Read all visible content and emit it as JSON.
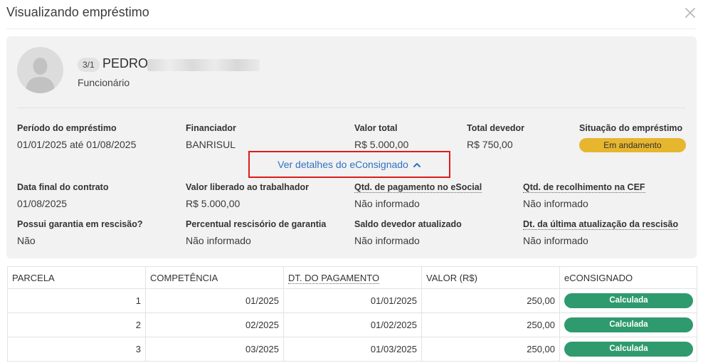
{
  "modal": {
    "title": "Visualizando empréstimo",
    "close_icon": "close-icon"
  },
  "employee": {
    "code": "3/1",
    "name": "PEDRO",
    "role": "Funcionário"
  },
  "summary": {
    "periodo_label": "Período do empréstimo",
    "periodo_value": "01/01/2025 até 01/08/2025",
    "financiador_label": "Financiador",
    "financiador_value": "BANRISUL",
    "valor_total_label": "Valor total",
    "valor_total_value": "R$ 5.000,00",
    "total_devedor_label": "Total devedor",
    "total_devedor_value": "R$ 750,00",
    "situacao_label": "Situação do empréstimo",
    "situacao_value": "Em andamento",
    "situacao_color": "#e7b62f"
  },
  "details_link": {
    "label": "Ver detalhes do eConsignado",
    "icon": "chevron-up-icon"
  },
  "details": {
    "data_final_label": "Data final do contrato",
    "data_final_value": "01/08/2025",
    "valor_liberado_label": "Valor liberado ao trabalhador",
    "valor_liberado_value": "R$ 5.000,00",
    "qtd_esocial_label": "Qtd. de pagamento no eSocial",
    "qtd_esocial_value": "Não informado",
    "qtd_cef_label": "Qtd. de recolhimento na CEF",
    "qtd_cef_value": "Não informado",
    "garantia_label": "Possui garantia em rescisão?",
    "garantia_value": "Não",
    "percentual_label": "Percentual rescisório de garantia",
    "percentual_value": "Não informado",
    "saldo_label": "Saldo devedor atualizado",
    "saldo_value": "Não informado",
    "dt_atualizacao_label": "Dt. da última atualização da rescisão",
    "dt_atualizacao_value": "Não informado"
  },
  "table": {
    "headers": {
      "parcela": "PARCELA",
      "competencia": "COMPETÊNCIA",
      "dt_pagamento": "DT. DO PAGAMENTO",
      "valor": "VALOR (R$)",
      "econsignado": "eCONSIGNADO"
    },
    "status_color": "#2f9a6d",
    "rows": [
      {
        "parcela": "1",
        "competencia": "01/2025",
        "dt_pagamento": "01/01/2025",
        "valor": "250,00",
        "status": "Calculada"
      },
      {
        "parcela": "2",
        "competencia": "02/2025",
        "dt_pagamento": "01/02/2025",
        "valor": "250,00",
        "status": "Calculada"
      },
      {
        "parcela": "3",
        "competencia": "03/2025",
        "dt_pagamento": "01/03/2025",
        "valor": "250,00",
        "status": "Calculada"
      }
    ]
  }
}
